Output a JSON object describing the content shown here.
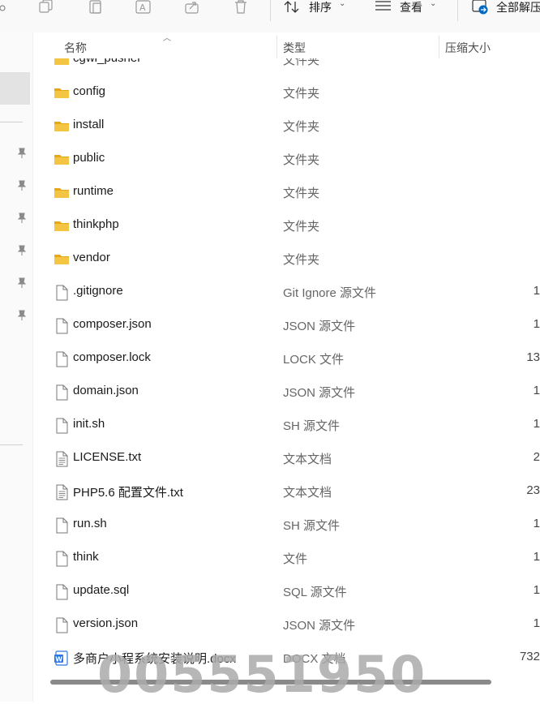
{
  "toolbar": {
    "sort_label": "排序",
    "view_label": "查看",
    "extract_label": "全部解压"
  },
  "columns": {
    "name": "名称",
    "type": "类型",
    "compressed_size": "压缩大小"
  },
  "files": [
    {
      "name": "cgwl_pusher",
      "type": "文件夹",
      "size": "",
      "icon": "folder-icon"
    },
    {
      "name": "config",
      "type": "文件夹",
      "size": "",
      "icon": "folder-icon"
    },
    {
      "name": "install",
      "type": "文件夹",
      "size": "",
      "icon": "folder-icon"
    },
    {
      "name": "public",
      "type": "文件夹",
      "size": "",
      "icon": "folder-icon"
    },
    {
      "name": "runtime",
      "type": "文件夹",
      "size": "",
      "icon": "folder-icon"
    },
    {
      "name": "thinkphp",
      "type": "文件夹",
      "size": "",
      "icon": "folder-icon"
    },
    {
      "name": "vendor",
      "type": "文件夹",
      "size": "",
      "icon": "folder-icon"
    },
    {
      "name": ".gitignore",
      "type": "Git Ignore 源文件",
      "size": "1",
      "icon": "file-icon"
    },
    {
      "name": "composer.json",
      "type": "JSON 源文件",
      "size": "1",
      "icon": "file-icon"
    },
    {
      "name": "composer.lock",
      "type": "LOCK 文件",
      "size": "13",
      "icon": "file-icon"
    },
    {
      "name": "domain.json",
      "type": "JSON 源文件",
      "size": "1",
      "icon": "file-icon"
    },
    {
      "name": "init.sh",
      "type": "SH 源文件",
      "size": "1",
      "icon": "file-icon"
    },
    {
      "name": "LICENSE.txt",
      "type": "文本文档",
      "size": "2",
      "icon": "text-file-icon"
    },
    {
      "name": "PHP5.6 配置文件.txt",
      "type": "文本文档",
      "size": "23",
      "icon": "text-file-icon"
    },
    {
      "name": "run.sh",
      "type": "SH 源文件",
      "size": "1",
      "icon": "file-icon"
    },
    {
      "name": "think",
      "type": "文件",
      "size": "1",
      "icon": "file-icon"
    },
    {
      "name": "update.sql",
      "type": "SQL 源文件",
      "size": "1",
      "icon": "file-icon"
    },
    {
      "name": "version.json",
      "type": "JSON 源文件",
      "size": "1",
      "icon": "file-icon"
    },
    {
      "name": "多商户小程系统安装说明.docx",
      "type": "DOCX 文档",
      "size": "732",
      "icon": "word-doc-icon"
    }
  ],
  "watermark": "005551950",
  "colors": {
    "folder": "#f4c542",
    "word": "#2b78e4",
    "accent": "#0067c0"
  }
}
